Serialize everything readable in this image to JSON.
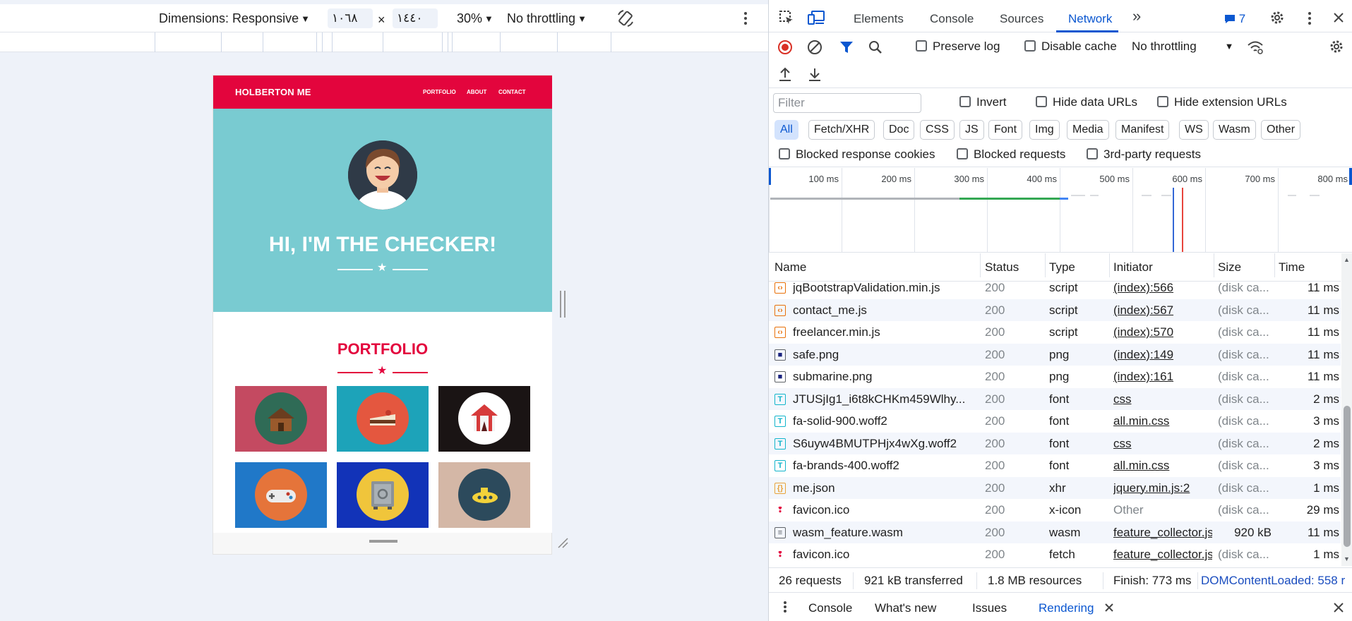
{
  "device_toolbar": {
    "dimensions_label": "Dimensions: Responsive",
    "width_value": "١٠٦٨",
    "times": "×",
    "height_value": "١٤٤٠",
    "zoom": "30%",
    "throttling": "No throttling"
  },
  "site": {
    "brand": "HOLBERTON ME",
    "nav": [
      "PORTFOLIO",
      "ABOUT",
      "CONTACT"
    ],
    "hero_title": "HI, I'M THE CHECKER!",
    "portfolio_title": "PORTFOLIO",
    "colors": {
      "nav": "#e3053d",
      "hero": "#79cbd1"
    }
  },
  "devtools": {
    "tabs": [
      "Elements",
      "Console",
      "Sources",
      "Network"
    ],
    "selected_tab": "Network",
    "more_tabs": "»",
    "message_count": "7",
    "preserve_log": "Preserve log",
    "disable_cache": "Disable cache",
    "throttling": "No throttling",
    "filter_placeholder": "Filter",
    "invert": "Invert",
    "hide_data_urls": "Hide data URLs",
    "hide_extension_urls": "Hide extension URLs",
    "type_filters": [
      "All",
      "Fetch/XHR",
      "Doc",
      "CSS",
      "JS",
      "Font",
      "Img",
      "Media",
      "Manifest",
      "WS",
      "Wasm",
      "Other"
    ],
    "blocked_response_cookies": "Blocked response cookies",
    "blocked_requests": "Blocked requests",
    "third_party_requests": "3rd-party requests",
    "timeline_ticks": [
      "100 ms",
      "200 ms",
      "300 ms",
      "400 ms",
      "500 ms",
      "600 ms",
      "700 ms",
      "800 ms"
    ],
    "columns": [
      "Name",
      "Status",
      "Type",
      "Initiator",
      "Size",
      "Time"
    ],
    "rows": [
      {
        "name": "jqBootstrapValidation.min.js",
        "status": "200",
        "type": "script",
        "initiator": "(index):566",
        "size": "(disk ca...",
        "time": "11 ms",
        "icon": "script-icon"
      },
      {
        "name": "contact_me.js",
        "status": "200",
        "type": "script",
        "initiator": "(index):567",
        "size": "(disk ca...",
        "time": "11 ms",
        "icon": "script-icon"
      },
      {
        "name": "freelancer.min.js",
        "status": "200",
        "type": "script",
        "initiator": "(index):570",
        "size": "(disk ca...",
        "time": "11 ms",
        "icon": "script-icon"
      },
      {
        "name": "safe.png",
        "status": "200",
        "type": "png",
        "initiator": "(index):149",
        "size": "(disk ca...",
        "time": "11 ms",
        "icon": "image-icon"
      },
      {
        "name": "submarine.png",
        "status": "200",
        "type": "png",
        "initiator": "(index):161",
        "size": "(disk ca...",
        "time": "11 ms",
        "icon": "image-icon"
      },
      {
        "name": "JTUSjIg1_i6t8kCHKm459Wlhy...",
        "status": "200",
        "type": "font",
        "initiator": "css",
        "size": "(disk ca...",
        "time": "2 ms",
        "icon": "font-icon"
      },
      {
        "name": "fa-solid-900.woff2",
        "status": "200",
        "type": "font",
        "initiator": "all.min.css",
        "size": "(disk ca...",
        "time": "3 ms",
        "icon": "font-icon"
      },
      {
        "name": "S6uyw4BMUTPHjx4wXg.woff2",
        "status": "200",
        "type": "font",
        "initiator": "css",
        "size": "(disk ca...",
        "time": "2 ms",
        "icon": "font-icon"
      },
      {
        "name": "fa-brands-400.woff2",
        "status": "200",
        "type": "font",
        "initiator": "all.min.css",
        "size": "(disk ca...",
        "time": "3 ms",
        "icon": "font-icon"
      },
      {
        "name": "me.json",
        "status": "200",
        "type": "xhr",
        "initiator": "jquery.min.js:2",
        "size": "(disk ca...",
        "time": "1 ms",
        "icon": "xhr-icon"
      },
      {
        "name": "favicon.ico",
        "status": "200",
        "type": "x-icon",
        "initiator": "Other",
        "size": "(disk ca...",
        "time": "29 ms",
        "icon": "favicon-icon"
      },
      {
        "name": "wasm_feature.wasm",
        "status": "200",
        "type": "wasm",
        "initiator": "feature_collector.js",
        "size": "920 kB",
        "time": "11 ms",
        "icon": "wasm-icon"
      },
      {
        "name": "favicon.ico",
        "status": "200",
        "type": "fetch",
        "initiator": "feature_collector.js",
        "size": "(disk ca...",
        "time": "1 ms",
        "icon": "favicon-icon"
      }
    ],
    "summary": {
      "requests": "26 requests",
      "transferred": "921 kB transferred",
      "resources": "1.8 MB resources",
      "finish": "Finish: 773 ms",
      "dcl": "DOMContentLoaded: 558 r"
    },
    "drawer_tabs": [
      "Console",
      "What's new",
      "Issues",
      "Rendering"
    ],
    "drawer_selected": "Rendering"
  }
}
